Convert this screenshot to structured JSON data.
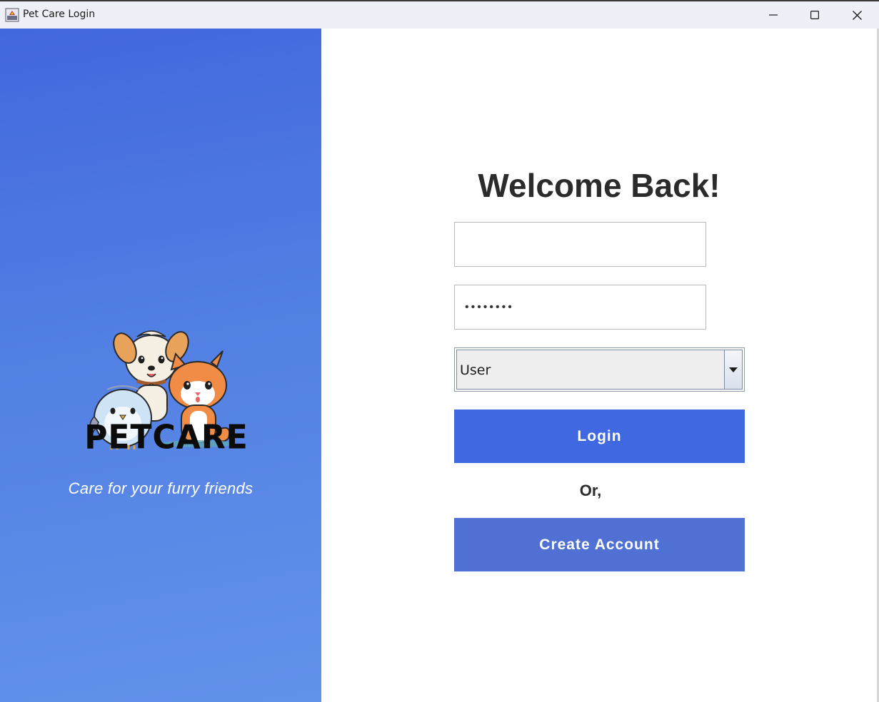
{
  "window": {
    "title": "Pet Care Login",
    "controls": {
      "minimize": "minimize-icon",
      "maximize": "maximize-icon",
      "close": "close-icon"
    }
  },
  "brand": {
    "logo_text": "PETCARE",
    "tagline": "Care for your furry friends",
    "panel_gradient": [
      "#4268dd",
      "#6392ea"
    ]
  },
  "form": {
    "heading": "Welcome Back!",
    "username": {
      "value": "",
      "placeholder": ""
    },
    "password": {
      "value": "••••••••",
      "masked": true
    },
    "role": {
      "selected": "User"
    },
    "login_label": "Login",
    "separator_label": "Or,",
    "create_account_label": "Create Account"
  },
  "colors": {
    "login_button": "#4068e0",
    "create_account_button": "#5170d4",
    "heading_text": "#2b2b2b"
  }
}
